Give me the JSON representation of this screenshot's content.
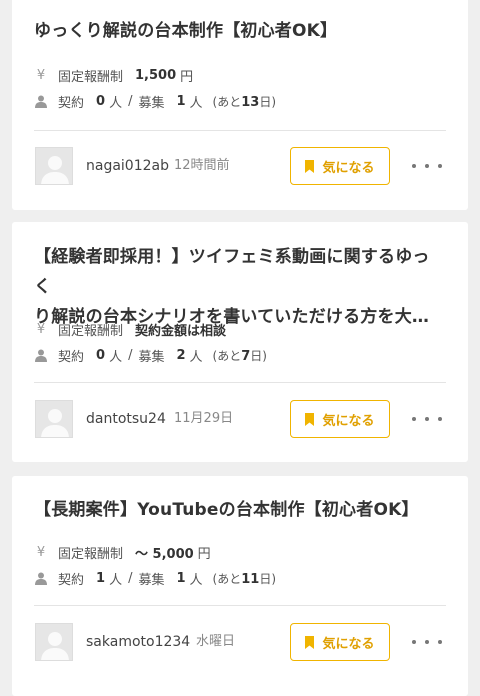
{
  "jobs": [
    {
      "title_lines": [
        "ゆっくり解説の台本制作【初心者OK】"
      ],
      "pay_icon": "yen-icon",
      "pay_label": "固定報酬制",
      "pay_value": "1,500",
      "pay_unit": "円",
      "people_icon": "person-icon",
      "contract_label": "契約",
      "contract_count": "0",
      "contract_unit": "人",
      "separator": "/",
      "recruit_label": "募集",
      "recruit_count": "1",
      "recruit_unit": "人",
      "remain_prefix": "(あと",
      "remain_days": "13",
      "remain_suffix": "日)",
      "user": "nagai012ab",
      "date": "12時間前",
      "fav_label": "気になる"
    },
    {
      "title_lines": [
        "【経験者即採用！】ツイフェミ系動画に関するゆっく",
        "り解説の台本シナリオを書いていただける方を大…"
      ],
      "pay_icon": "yen-icon",
      "pay_label": "固定報酬制",
      "pay_value": "契約金額は相談",
      "pay_unit": "",
      "people_icon": "person-icon",
      "contract_label": "契約",
      "contract_count": "0",
      "contract_unit": "人",
      "separator": "/",
      "recruit_label": "募集",
      "recruit_count": "2",
      "recruit_unit": "人",
      "remain_prefix": "(あと",
      "remain_days": "7",
      "remain_suffix": "日)",
      "user": "dantotsu24",
      "date": "11月29日",
      "fav_label": "気になる"
    },
    {
      "title_lines": [
        "【長期案件】YouTubeの台本制作【初心者OK】"
      ],
      "pay_icon": "yen-icon",
      "pay_label": "固定報酬制",
      "pay_value": "〜 5,000",
      "pay_unit": "円",
      "people_icon": "person-icon",
      "contract_label": "契約",
      "contract_count": "1",
      "contract_unit": "人",
      "separator": "/",
      "recruit_label": "募集",
      "recruit_count": "1",
      "recruit_unit": "人",
      "remain_prefix": "(あと",
      "remain_days": "11",
      "remain_suffix": "日)",
      "user": "sakamoto1234",
      "date": "水曜日",
      "fav_label": "気になる"
    }
  ],
  "colors": {
    "accent": "#f0b400",
    "accent_text": "#e0a000",
    "background": "#efefef",
    "card": "#ffffff"
  }
}
